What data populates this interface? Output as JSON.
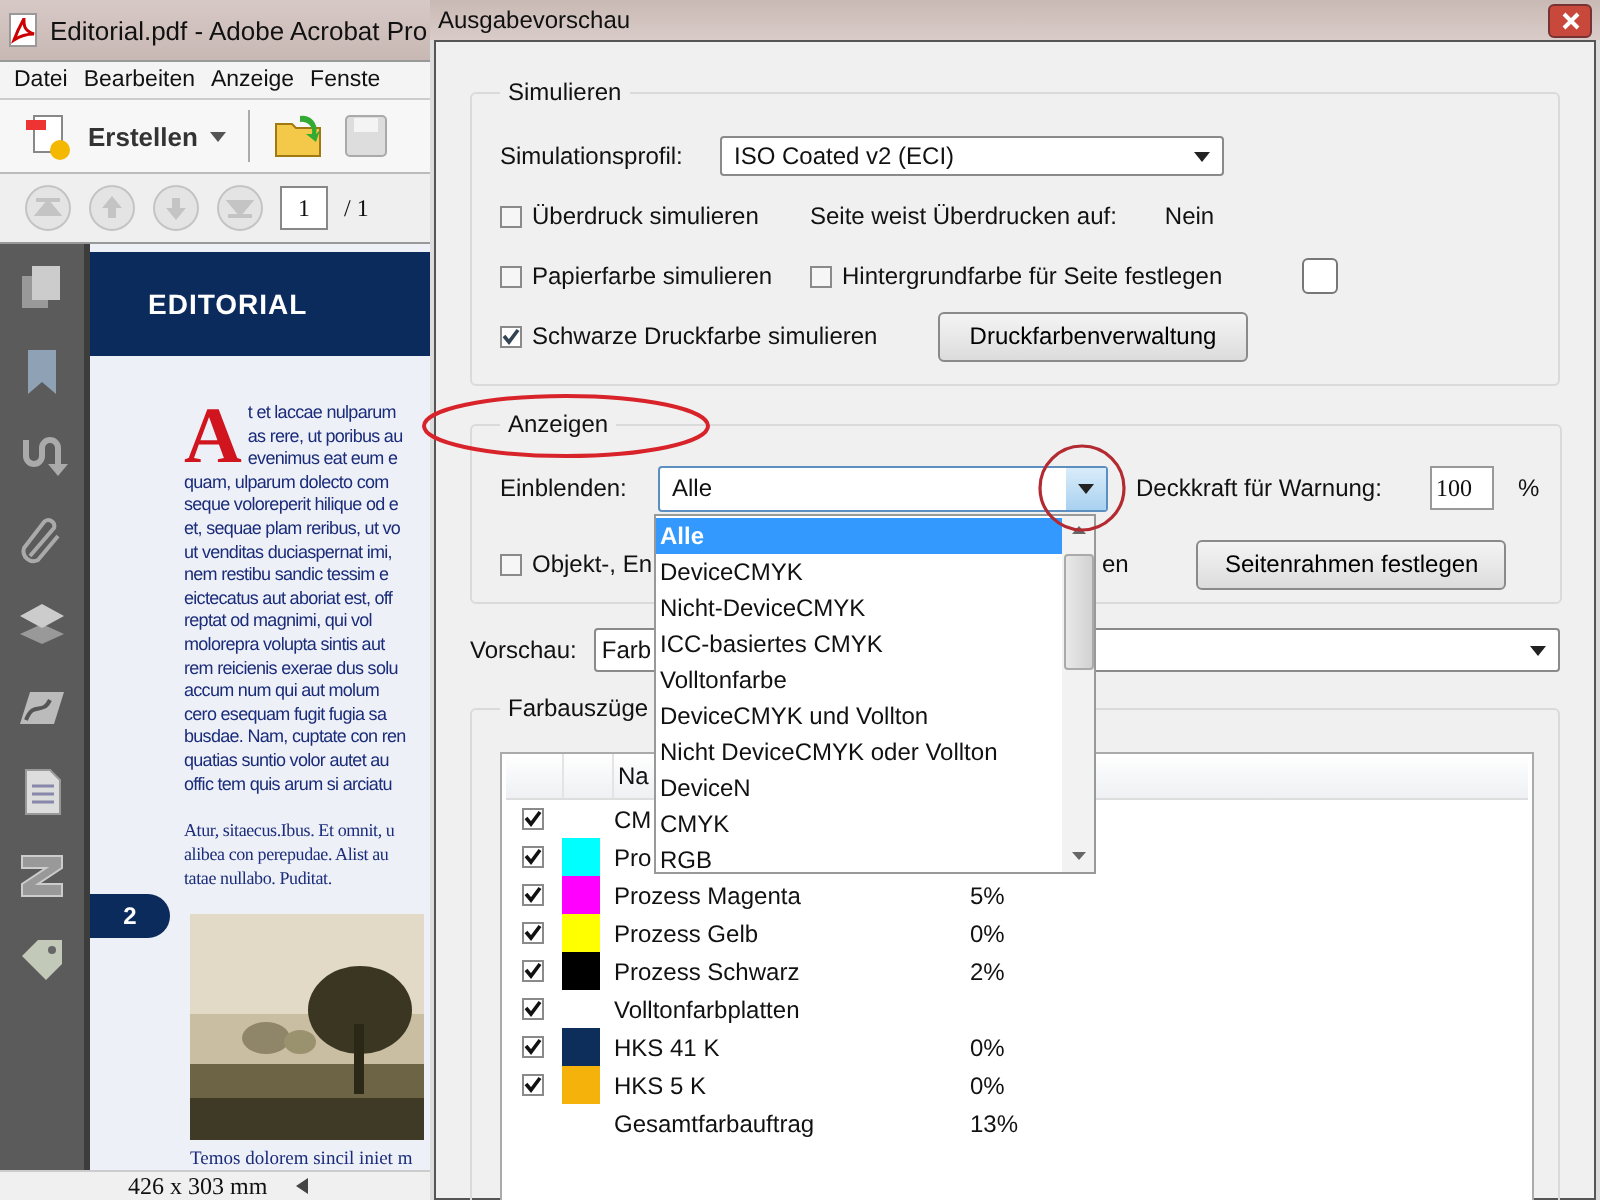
{
  "acrobat": {
    "title": "Editorial.pdf - Adobe Acrobat Pro",
    "menu": [
      "Datei",
      "Bearbeiten",
      "Anzeige",
      "Fenste"
    ],
    "create_button": "Erstellen",
    "page_field": "1",
    "page_total": "/ 1",
    "document": {
      "heading": "EDITORIAL",
      "drop_cap": "A",
      "cap_lines": [
        "t et laccae nulparum",
        "as rere, ut poribus au",
        "evenimus eat eum e"
      ],
      "body_lines": [
        "quam, ulparum dolecto com",
        "seque voloreperit hilique od e",
        "et, sequae plam reribus, ut vo",
        "ut venditas duciaspernat imi,",
        "nem restibu sandic tessim e",
        "eictecatus aut aboriat est, off",
        "reptat od magnimi, qui vol",
        "molorepra volupta sintis aut",
        "rem reicienis exerae dus solu",
        "accum num qui aut molum",
        "cero esequam fugit fugia sa",
        "busdae. Nam, cuptate con ren",
        "quatias suntio volor autet au",
        "offic tem quis arum si arciatu"
      ],
      "serif_lines": [
        "Atur, sitaecus.Ibus. Et omnit, u",
        "alibea con perepudae. Alist au",
        "tatae nullabo. Puditat."
      ],
      "page_tab": "2",
      "footer_line": "Temos dolorem sincil iniet m"
    },
    "status": "426 x 303 mm"
  },
  "dialog": {
    "title": "Ausgabevorschau",
    "simulate": {
      "legend": "Simulieren",
      "profile_label": "Simulationsprofil:",
      "profile_value": "ISO Coated v2 (ECI)",
      "overprint": {
        "label": "Überdruck simulieren",
        "checked": false
      },
      "overprint_info": "Seite weist Überdrucken auf:",
      "overprint_value": "Nein",
      "paper": {
        "label": "Papierfarbe simulieren",
        "checked": false
      },
      "background": {
        "label": "Hintergrundfarbe für Seite festlegen",
        "checked": false
      },
      "black": {
        "label": "Schwarze Druckfarbe simulieren",
        "checked": true
      },
      "ink_button": "Druckfarbenverwaltung"
    },
    "show": {
      "legend": "Anzeigen",
      "show_label": "Einblenden:",
      "show_value": "Alle",
      "opacity_label": "Deckkraft für Warnung:",
      "opacity_value": "100",
      "percent": "%",
      "object": {
        "label": "Objekt-, En",
        "checked": false
      },
      "object_tail": "en",
      "frame_button": "Seitenrahmen festlegen"
    },
    "preview_label": "Vorschau:",
    "preview_value": "Farb",
    "separations": {
      "legend": "Farbauszüge",
      "header": "Na",
      "rows": [
        {
          "checked": true,
          "name": "CM"
        },
        {
          "checked": true,
          "color": "#00ffff",
          "name": "Pro"
        },
        {
          "checked": true,
          "color": "#ff00ff",
          "name": "Prozess Magenta",
          "value": "5%"
        },
        {
          "checked": true,
          "color": "#ffff00",
          "name": "Prozess Gelb",
          "value": "0%"
        },
        {
          "checked": true,
          "color": "#000000",
          "name": "Prozess Schwarz",
          "value": "2%"
        },
        {
          "checked": true,
          "name": "Volltonfarbplatten"
        },
        {
          "checked": true,
          "color": "#0d2d5a",
          "name": "HKS 41 K",
          "value": "0%"
        },
        {
          "checked": true,
          "color": "#f5b20a",
          "name": "HKS 5 K",
          "value": "0%"
        },
        {
          "name": "Gesamtfarbauftrag",
          "value": "13%"
        }
      ]
    },
    "dropdown": [
      {
        "label": "Alle",
        "selected": true
      },
      {
        "label": "DeviceCMYK",
        "selected": false
      },
      {
        "label": "Nicht-DeviceCMYK",
        "selected": false
      },
      {
        "label": "ICC-basiertes CMYK",
        "selected": false
      },
      {
        "label": "Volltonfarbe",
        "selected": false
      },
      {
        "label": "DeviceCMYK und Vollton",
        "selected": false
      },
      {
        "label": "Nicht DeviceCMYK oder Vollton",
        "selected": false
      },
      {
        "label": "DeviceN",
        "selected": false
      },
      {
        "label": "CMYK",
        "selected": false
      },
      {
        "label": "RGB",
        "selected": false
      }
    ]
  }
}
